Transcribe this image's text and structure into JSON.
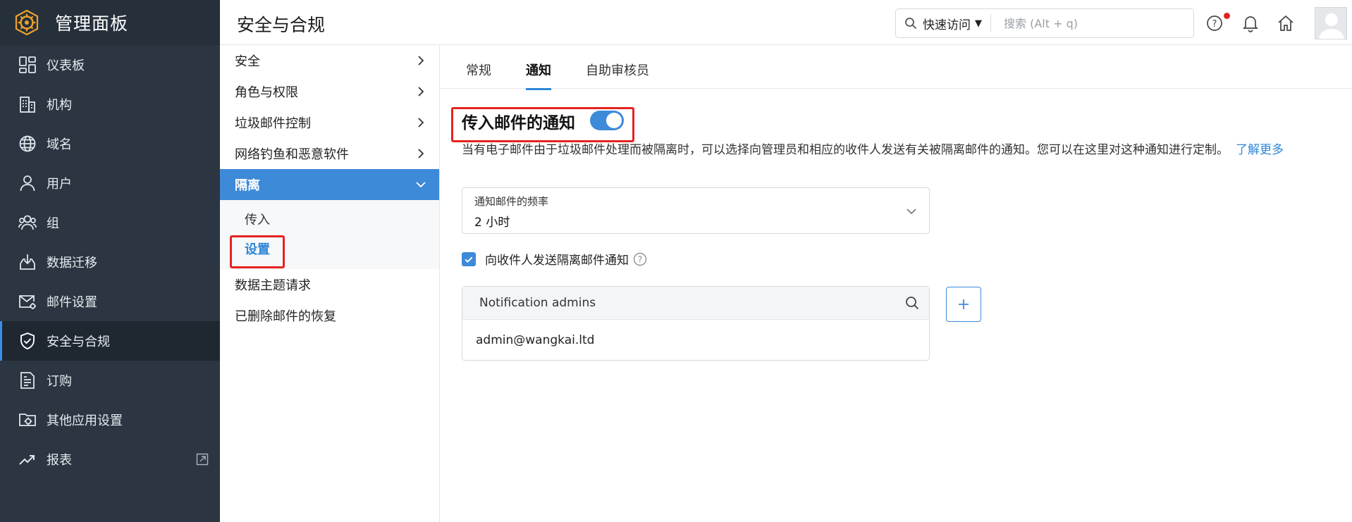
{
  "sidebar": {
    "title": "管理面板",
    "items": [
      {
        "label": "仪表板",
        "icon": "dashboard-icon"
      },
      {
        "label": "机构",
        "icon": "building-icon"
      },
      {
        "label": "域名",
        "icon": "globe-icon"
      },
      {
        "label": "用户",
        "icon": "user-icon"
      },
      {
        "label": "组",
        "icon": "group-icon"
      },
      {
        "label": "数据迁移",
        "icon": "download-tray-icon"
      },
      {
        "label": "邮件设置",
        "icon": "mail-settings-icon"
      },
      {
        "label": "安全与合规",
        "icon": "shield-icon",
        "active": true
      },
      {
        "label": "订购",
        "icon": "invoice-icon"
      },
      {
        "label": "其他应用设置",
        "icon": "apps-settings-icon"
      },
      {
        "label": "报表",
        "icon": "trend-icon"
      }
    ]
  },
  "header": {
    "title": "安全与合规",
    "quick_access": "快速访问",
    "search_placeholder": "搜索 (Alt + q)"
  },
  "subnav": {
    "items": [
      {
        "label": "安全"
      },
      {
        "label": "角色与权限"
      },
      {
        "label": "垃圾邮件控制"
      },
      {
        "label": "网络钓鱼和恶意软件"
      },
      {
        "label": "隔离",
        "expanded": true
      },
      {
        "label": "数据主题请求"
      },
      {
        "label": "已删除邮件的恢复"
      }
    ],
    "children": [
      {
        "label": "传入"
      },
      {
        "label": "设置",
        "active": true
      }
    ]
  },
  "tabs": [
    {
      "label": "常规"
    },
    {
      "label": "通知",
      "active": true
    },
    {
      "label": "自助审核员"
    }
  ],
  "section": {
    "title": "传入邮件的通知",
    "toggle_on": true,
    "description": "当有电子邮件由于垃圾邮件处理而被隔离时，可以选择向管理员和相应的收件人发送有关被隔离邮件的通知。您可以在这里对这种通知进行定制。",
    "learn_more": "了解更多"
  },
  "frequency": {
    "label": "通知邮件的频率",
    "value": "2 小时"
  },
  "recipient_notify": {
    "label": "向收件人发送隔离邮件通知",
    "checked": true
  },
  "admins": {
    "header": "Notification admins",
    "list": [
      "admin@wangkai.ltd"
    ]
  },
  "colors": {
    "sidebar_bg": "#2b3642",
    "accent": "#3d8ad9",
    "highlight": "#e52321"
  }
}
